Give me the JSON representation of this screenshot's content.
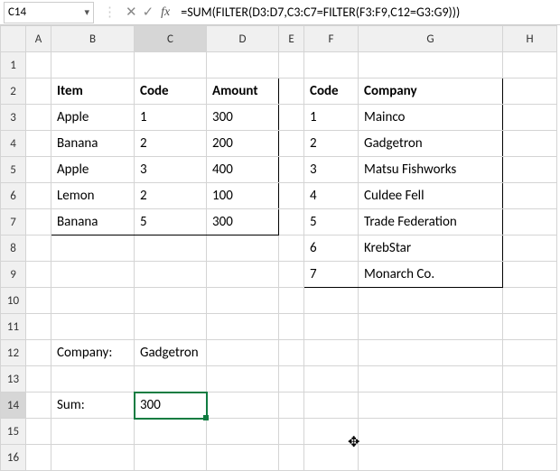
{
  "namebox": "C14",
  "formula": "=SUM(FILTER(D3:D7,C3:C7=FILTER(F3:F9,C12=G3:G9)))",
  "colHeaders": [
    "A",
    "B",
    "C",
    "D",
    "E",
    "F",
    "G",
    "H"
  ],
  "rowHeaders": [
    "1",
    "2",
    "3",
    "4",
    "5",
    "6",
    "7",
    "8",
    "9",
    "10",
    "11",
    "12",
    "13",
    "14",
    "15",
    "16"
  ],
  "table1": {
    "h": {
      "item": "Item",
      "code": "Code",
      "amount": "Amount"
    },
    "rows": [
      {
        "item": "Apple",
        "code": "1",
        "amount": "300"
      },
      {
        "item": "Banana",
        "code": "2",
        "amount": "200"
      },
      {
        "item": "Apple",
        "code": "3",
        "amount": "400"
      },
      {
        "item": "Lemon",
        "code": "2",
        "amount": "100"
      },
      {
        "item": "Banana",
        "code": "5",
        "amount": "300"
      }
    ]
  },
  "table2": {
    "h": {
      "code": "Code",
      "company": "Company"
    },
    "rows": [
      {
        "code": "1",
        "company": "Mainco"
      },
      {
        "code": "2",
        "company": "Gadgetron"
      },
      {
        "code": "3",
        "company": "Matsu Fishworks"
      },
      {
        "code": "4",
        "company": "Culdee Fell"
      },
      {
        "code": "5",
        "company": "Trade Federation"
      },
      {
        "code": "6",
        "company": "KrebStar"
      },
      {
        "code": "7",
        "company": "Monarch Co."
      }
    ]
  },
  "labels": {
    "companyLabel": "Company:",
    "companyValue": "Gadgetron",
    "sumLabel": "Sum:",
    "sumValue": "300"
  },
  "icons": {
    "chevdown": "▾",
    "cancel": "✕",
    "accept": "✓",
    "fx": "fx",
    "crosscursor": "✥"
  }
}
